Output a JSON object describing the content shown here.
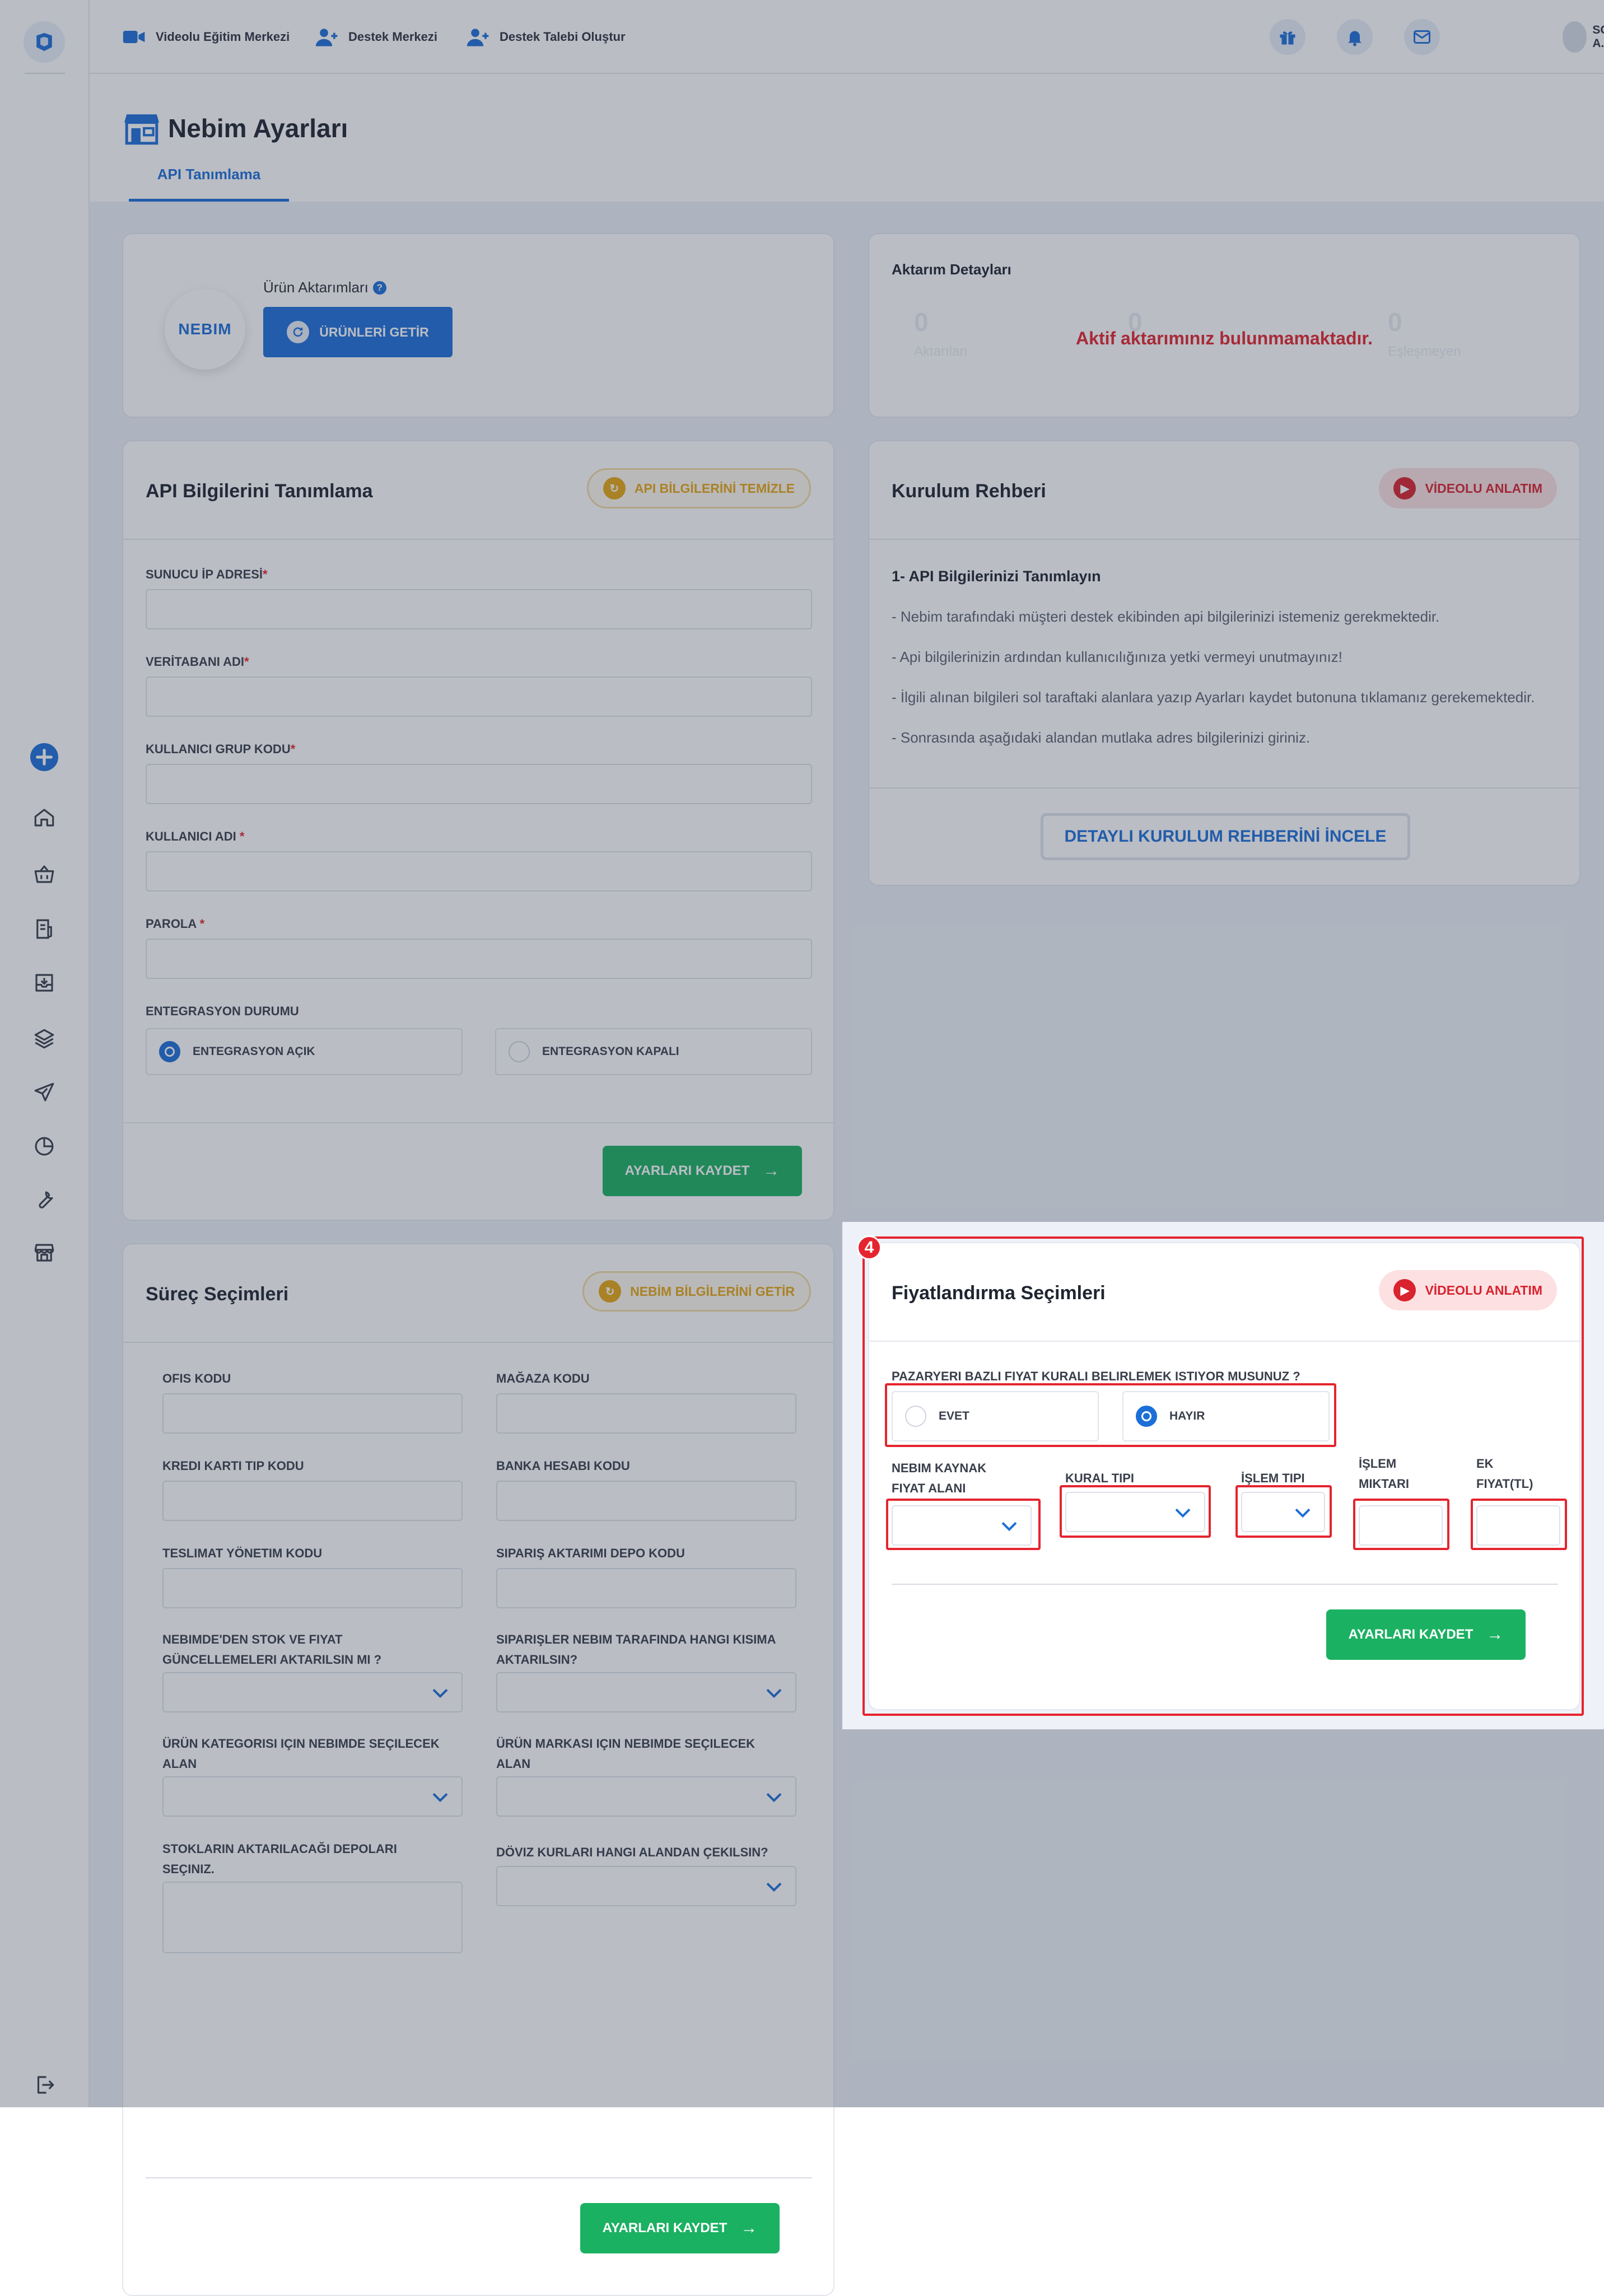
{
  "topbar": {
    "links": [
      "Videolu Eğitim Merkezi",
      "Destek Merkezi",
      "Destek Talebi Oluştur"
    ],
    "user": "SOPYO A.Ş."
  },
  "page": {
    "title": "Nebim Ayarları",
    "tab": "API Tanımlama"
  },
  "products": {
    "label": "Ürün Aktarımları",
    "logo_text": "NEBIM",
    "button": "ÜRÜNLERİ GETİR"
  },
  "transfer": {
    "title": "Aktarım Detayları",
    "empty_message": "Aktif aktarımınız bulunmamaktadır.",
    "stats": [
      {
        "value": "0",
        "label": "Aktarılan"
      },
      {
        "value": "0",
        "label": ""
      },
      {
        "value": "0",
        "label": "Eşleşmeyen"
      }
    ]
  },
  "api": {
    "title": "API Bilgilerini Tanımlama",
    "clear_button": "API BİLGİLERİNİ TEMİZLE",
    "fields": [
      {
        "label": "SUNUCU İP ADRESİ",
        "req": "*"
      },
      {
        "label": "VERİTABANI ADI",
        "req": "*"
      },
      {
        "label": "KULLANICI GRUP KODU",
        "req": "*"
      },
      {
        "label": "KULLANICI ADI ",
        "req": "*"
      },
      {
        "label": "PAROLA ",
        "req": "*"
      }
    ],
    "integration_label": "ENTEGRASYON DURUMU",
    "integration_on": "ENTEGRASYON AÇIK",
    "integration_off": "ENTEGRASYON KAPALI",
    "integration_value": "on",
    "save": "AYARLARI KAYDET"
  },
  "guide": {
    "title": "Kurulum Rehberi",
    "video_button": "VİDEOLU ANLATIM",
    "step_title": "1- API Bilgilerinizi Tanımlayın",
    "lines": [
      "- Nebim tarafındaki müşteri destek ekibinden api bilgilerinizi istemeniz gerekmektedir.",
      "- Api bilgilerinizin ardından kullanıcılığınıza yetki vermeyi unutmayınız!",
      "- İlgili alınan bilgileri sol taraftaki alanlara yazıp Ayarları kaydet butonuna tıklamanız gerekemektedir.",
      "- Sonrasında aşağıdaki alandan mutlaka adres bilgilerinizi giriniz."
    ],
    "detail_button": "DETAYLI KURULUM REHBERİNİ İNCELE"
  },
  "process": {
    "title": "Süreç Seçimleri",
    "fetch_button": "NEBİM BİLGİLERİNİ GETİR",
    "fields": {
      "office": "OFIS KODU",
      "store": "MAĞAZA KODU",
      "card": "KREDI KARTI TIP KODU",
      "bank": "BANKA HESABI KODU",
      "delivery": "TESLIMAT YÖNETIM KODU",
      "depot": "SIPARIŞ AKTARIMI DEPO KODU",
      "stock_l1": "NEBIMDE'DEN STOK VE FIYAT",
      "stock_l2": "GÜNCELLEMELERI AKTARILSIN MI ?",
      "orders_l1": "SIPARIŞLER NEBIM TARAFINDA HANGI KISIMA",
      "orders_l2": "AKTARILSIN?",
      "category_l1": "ÜRÜN KATEGORISI IÇIN NEBIMDE SEÇILECEK",
      "category_l2": "ALAN",
      "brand_l1": "ÜRÜN MARKASI IÇIN NEBIMDE SEÇILECEK",
      "brand_l2": "ALAN",
      "stocks_l1": "STOKLARIN AKTARILACAĞI DEPOLARI",
      "stocks_l2": "SEÇINIZ.",
      "currency": "DÖVIZ KURLARI HANGI ALANDAN ÇEKILSIN?"
    },
    "save": "AYARLARI KAYDET"
  },
  "pricing": {
    "badge": "4",
    "title": "Fiyatlandırma Seçimleri",
    "video_button": "VİDEOLU ANLATIM",
    "question": "PAZARYERI BAZLI FIYAT KURALI BELIRLEMEK ISTIYOR MUSUNUZ ?",
    "yes": "EVET",
    "no": "HAYIR",
    "selected": "no",
    "source_l1": "NEBIM KAYNAK",
    "source_l2": "FIYAT ALANI",
    "rule_type": "KURAL TIPI",
    "op_type": "İŞLEM TIPI",
    "op_amount_l1": "İŞLEM",
    "op_amount_l2": "MIKTARI",
    "extra_l1": "EK",
    "extra_l2": "FIYAT(TL)",
    "save": "AYARLARI KAYDET"
  },
  "colors": {
    "primary": "#1d6fd8",
    "success": "#1bb162",
    "danger": "#e5242e",
    "warning": "#e6a814"
  },
  "icons": [
    "video-camera-icon",
    "user-plus-icon",
    "gift-icon",
    "bell-icon",
    "mail-icon",
    "chevron-down-icon",
    "plus-icon",
    "home-icon",
    "basket-icon",
    "invoice-icon",
    "archive-icon",
    "layers-icon",
    "send-icon",
    "pie-chart-icon",
    "wrench-icon",
    "store-icon",
    "logout-icon"
  ]
}
